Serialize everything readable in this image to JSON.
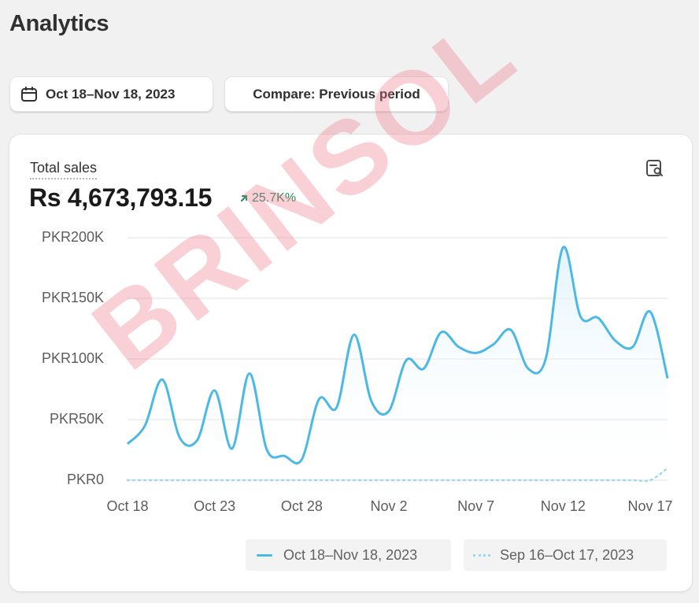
{
  "page": {
    "title": "Analytics"
  },
  "toolbar": {
    "date_range_label": "Oct 18–Nov 18, 2023",
    "compare_label": "Compare: Previous period"
  },
  "card": {
    "metric_label": "Total sales",
    "metric_value": "Rs 4,673,793.15",
    "metric_change": "25.7K%",
    "change_direction": "up",
    "change_color": "#1c8a5b"
  },
  "chart_data": {
    "type": "line",
    "title": "",
    "xlabel": "",
    "ylabel": "",
    "ylim": [
      0,
      200000
    ],
    "y_ticks": [
      "PKR0",
      "PKR50K",
      "PKR100K",
      "PKR150K",
      "PKR200K"
    ],
    "x_ticks": [
      "Oct 18",
      "Oct 23",
      "Oct 28",
      "Nov 2",
      "Nov 7",
      "Nov 12",
      "Nov 17"
    ],
    "x": [
      "Oct 18",
      "Oct 19",
      "Oct 20",
      "Oct 21",
      "Oct 22",
      "Oct 23",
      "Oct 24",
      "Oct 25",
      "Oct 26",
      "Oct 27",
      "Oct 28",
      "Oct 29",
      "Oct 30",
      "Oct 31",
      "Nov 1",
      "Nov 2",
      "Nov 3",
      "Nov 4",
      "Nov 5",
      "Nov 6",
      "Nov 7",
      "Nov 8",
      "Nov 9",
      "Nov 10",
      "Nov 11",
      "Nov 12",
      "Nov 13",
      "Nov 14",
      "Nov 15",
      "Nov 16",
      "Nov 17",
      "Nov 18"
    ],
    "grid": true,
    "series": [
      {
        "name": "Oct 18–Nov 18, 2023",
        "color": "#4bb8e6",
        "style": "solid",
        "values": [
          30000,
          45000,
          83000,
          35000,
          33000,
          74000,
          26000,
          88000,
          25000,
          20000,
          17000,
          67000,
          60000,
          120000,
          65000,
          57000,
          99000,
          92000,
          122000,
          110000,
          105000,
          112000,
          124000,
          92000,
          100000,
          192000,
          135000,
          134000,
          115000,
          110000,
          139000,
          84000
        ]
      },
      {
        "name": "Sep 16–Oct 17, 2023",
        "color": "#9bd9f0",
        "style": "dotted",
        "values": [
          0,
          0,
          0,
          0,
          0,
          0,
          0,
          0,
          0,
          0,
          0,
          0,
          0,
          0,
          0,
          0,
          0,
          0,
          0,
          0,
          0,
          0,
          0,
          0,
          0,
          0,
          0,
          0,
          0,
          0,
          0,
          10000
        ]
      }
    ]
  },
  "legend": {
    "current": "Oct 18–Nov 18, 2023",
    "previous": "Sep 16–Oct 17, 2023"
  },
  "watermark": "BRINSOL"
}
